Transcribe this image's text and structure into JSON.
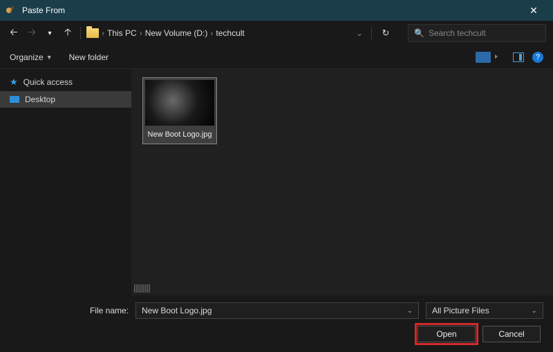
{
  "window": {
    "title": "Paste From"
  },
  "nav": {
    "crumbs": [
      "This PC",
      "New Volume (D:)",
      "techcult"
    ],
    "search_placeholder": "Search techcult"
  },
  "toolbar": {
    "organize": "Organize",
    "new_folder": "New folder"
  },
  "sidebar": {
    "items": [
      {
        "label": "Quick access"
      },
      {
        "label": "Desktop"
      }
    ]
  },
  "files": [
    {
      "name": "New Boot Logo.jpg"
    }
  ],
  "footer": {
    "filename_label": "File name:",
    "filename_value": "New Boot Logo.jpg",
    "filter": "All Picture Files",
    "open": "Open",
    "cancel": "Cancel"
  }
}
